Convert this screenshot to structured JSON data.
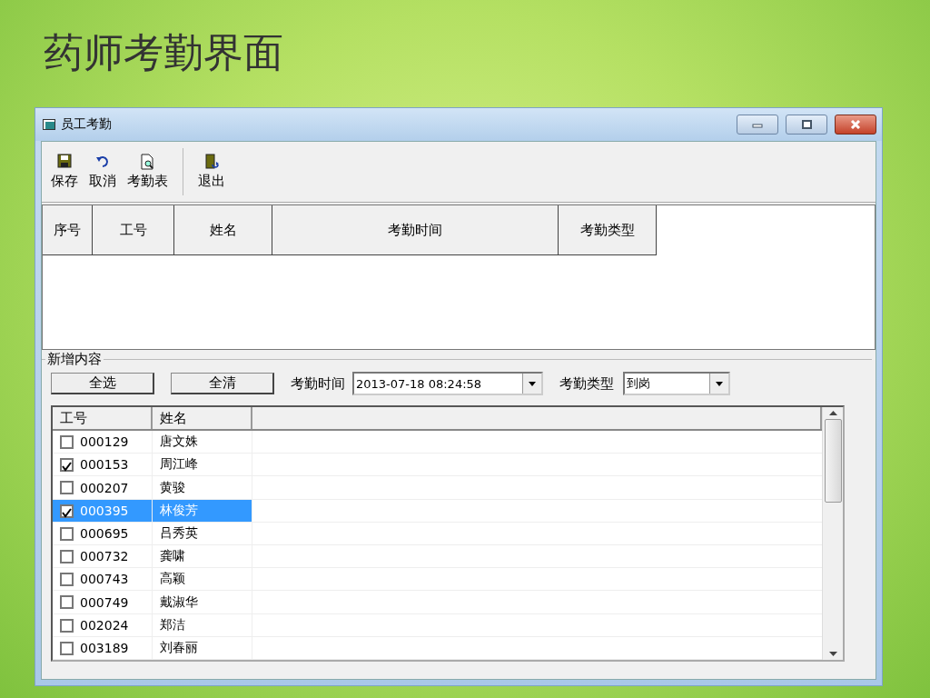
{
  "slide_title": "药师考勤界面",
  "window": {
    "title": "员工考勤"
  },
  "toolbar": [
    {
      "label": "保存",
      "kind": "save"
    },
    {
      "label": "取消",
      "kind": "undo"
    },
    {
      "label": "考勤表",
      "kind": "report"
    },
    {
      "label": "退出",
      "kind": "exit"
    }
  ],
  "grid": {
    "columns": [
      "序号",
      "工号",
      "姓名",
      "考勤时间",
      "考勤类型"
    ]
  },
  "group": {
    "title": "新增内容",
    "buttons": [
      "全选",
      "全清"
    ],
    "time_label": "考勤时间",
    "time_value": "2013-07-18 08:24:58",
    "type_label": "考勤类型",
    "type_value": "到岗"
  },
  "list": {
    "columns": [
      "工号",
      "姓名"
    ],
    "rows": [
      {
        "id": "000129",
        "name": "唐文姝",
        "checked": false,
        "selected": false
      },
      {
        "id": "000153",
        "name": "周江峰",
        "checked": true,
        "selected": false
      },
      {
        "id": "000207",
        "name": "黄骏",
        "checked": false,
        "selected": false
      },
      {
        "id": "000395",
        "name": "林俊芳",
        "checked": true,
        "selected": true
      },
      {
        "id": "000695",
        "name": "吕秀英",
        "checked": false,
        "selected": false
      },
      {
        "id": "000732",
        "name": "龚啸",
        "checked": false,
        "selected": false
      },
      {
        "id": "000743",
        "name": "高颖",
        "checked": false,
        "selected": false
      },
      {
        "id": "000749",
        "name": "戴淑华",
        "checked": false,
        "selected": false
      },
      {
        "id": "002024",
        "name": "郑洁",
        "checked": false,
        "selected": false
      },
      {
        "id": "003189",
        "name": "刘春丽",
        "checked": false,
        "selected": false
      }
    ]
  }
}
